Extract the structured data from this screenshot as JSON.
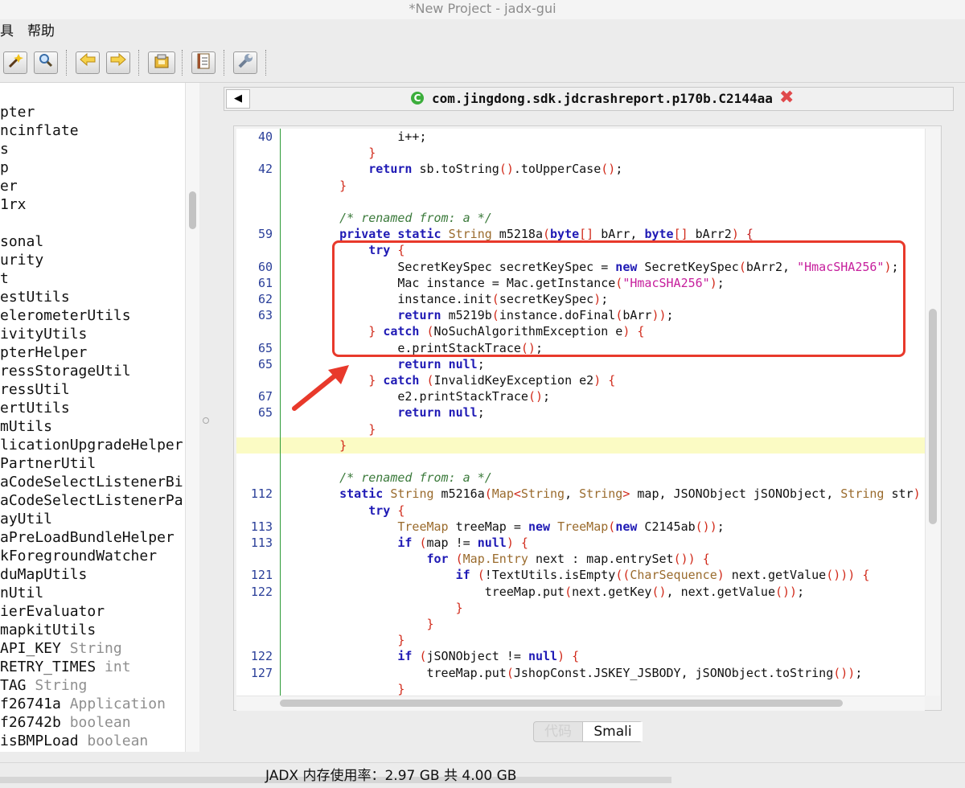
{
  "window": {
    "title": "*New Project - jadx-gui"
  },
  "menu": {
    "items": [
      "具",
      "帮助"
    ]
  },
  "toolbar": {
    "icons": [
      "wand-icon",
      "search-icon",
      "back-arrow-icon",
      "forward-arrow-icon",
      "decompile-icon",
      "log-icon",
      "preferences-icon"
    ]
  },
  "tree": {
    "items": [
      {
        "name": "pter",
        "type": ""
      },
      {
        "name": "ncinflate",
        "type": ""
      },
      {
        "name": "s",
        "type": ""
      },
      {
        "name": "p",
        "type": ""
      },
      {
        "name": "er",
        "type": ""
      },
      {
        "name": "1rx",
        "type": ""
      },
      {
        "name": "",
        "type": ""
      },
      {
        "name": "sonal",
        "type": ""
      },
      {
        "name": "urity",
        "type": ""
      },
      {
        "name": "t",
        "type": ""
      },
      {
        "name": "estUtils",
        "type": ""
      },
      {
        "name": "elerometerUtils",
        "type": ""
      },
      {
        "name": "ivityUtils",
        "type": ""
      },
      {
        "name": "pterHelper",
        "type": ""
      },
      {
        "name": "ressStorageUtil",
        "type": ""
      },
      {
        "name": "ressUtil",
        "type": ""
      },
      {
        "name": "ertUtils",
        "type": ""
      },
      {
        "name": "mUtils",
        "type": ""
      },
      {
        "name": "licationUpgradeHelper",
        "type": ""
      },
      {
        "name": "PartnerUtil",
        "type": ""
      },
      {
        "name": "aCodeSelectListenerBi",
        "type": ""
      },
      {
        "name": "aCodeSelectListenerPa",
        "type": ""
      },
      {
        "name": "ayUtil",
        "type": ""
      },
      {
        "name": "aPreLoadBundleHelper",
        "type": ""
      },
      {
        "name": "kForegroundWatcher",
        "type": ""
      },
      {
        "name": "duMapUtils",
        "type": ""
      },
      {
        "name": "nUtil",
        "type": ""
      },
      {
        "name": "ierEvaluator",
        "type": ""
      },
      {
        "name": "mapkitUtils",
        "type": ""
      },
      {
        "name": "API_KEY",
        "type": "String"
      },
      {
        "name": "RETRY_TIMES",
        "type": "int"
      },
      {
        "name": "TAG",
        "type": "String"
      },
      {
        "name": "f26741a",
        "type": "Application"
      },
      {
        "name": "f26742b",
        "type": "boolean"
      },
      {
        "name": "isBMPLoad",
        "type": "boolean"
      }
    ]
  },
  "tab": {
    "title": "com.jingdong.sdk.jdcrashreport.p170b.C2144aa",
    "back_label": "◀"
  },
  "code": {
    "lines": [
      {
        "num": "40",
        "hl": false
      },
      {
        "num": "",
        "hl": false
      },
      {
        "num": "42",
        "hl": false
      },
      {
        "num": "",
        "hl": false
      },
      {
        "num": "",
        "hl": false
      },
      {
        "num": "",
        "hl": false
      },
      {
        "num": "59",
        "hl": false
      },
      {
        "num": "",
        "hl": false
      },
      {
        "num": "60",
        "hl": false
      },
      {
        "num": "61",
        "hl": false
      },
      {
        "num": "62",
        "hl": false
      },
      {
        "num": "63",
        "hl": false
      },
      {
        "num": "",
        "hl": false
      },
      {
        "num": "65",
        "hl": false
      },
      {
        "num": "65",
        "hl": false
      },
      {
        "num": "",
        "hl": false
      },
      {
        "num": "67",
        "hl": false
      },
      {
        "num": "65",
        "hl": false
      },
      {
        "num": "",
        "hl": false
      },
      {
        "num": "",
        "hl": true
      },
      {
        "num": "",
        "hl": false
      },
      {
        "num": "",
        "hl": false
      },
      {
        "num": "112",
        "hl": false
      },
      {
        "num": "",
        "hl": false
      },
      {
        "num": "113",
        "hl": false
      },
      {
        "num": "113",
        "hl": false
      },
      {
        "num": "",
        "hl": false
      },
      {
        "num": "121",
        "hl": false
      },
      {
        "num": "122",
        "hl": false
      },
      {
        "num": "",
        "hl": false
      },
      {
        "num": "",
        "hl": false
      },
      {
        "num": "",
        "hl": false
      },
      {
        "num": "122",
        "hl": false
      },
      {
        "num": "127",
        "hl": false
      },
      {
        "num": "",
        "hl": false
      }
    ],
    "text": [
      [
        [
          "f",
          "            i++;"
        ]
      ],
      [
        [
          "f",
          "        "
        ],
        [
          "p",
          "}"
        ]
      ],
      [
        [
          "f",
          "        "
        ],
        [
          "k",
          "return"
        ],
        [
          "f",
          " sb.toString"
        ],
        [
          "p",
          "()"
        ],
        [
          "f",
          ".toUpperCase"
        ],
        [
          "p",
          "()"
        ],
        [
          "f",
          ";"
        ]
      ],
      [
        [
          "f",
          "    "
        ],
        [
          "p",
          "}"
        ]
      ],
      [
        [
          "f",
          ""
        ]
      ],
      [
        [
          "f",
          "    "
        ],
        [
          "c",
          "/* renamed from: a */"
        ]
      ],
      [
        [
          "f",
          "    "
        ],
        [
          "k",
          "private static"
        ],
        [
          "f",
          " "
        ],
        [
          "t",
          "String"
        ],
        [
          "f",
          " m5218a"
        ],
        [
          "p",
          "("
        ],
        [
          "k",
          "byte"
        ],
        [
          "p",
          "[]"
        ],
        [
          "f",
          " bArr, "
        ],
        [
          "k",
          "byte"
        ],
        [
          "p",
          "[]"
        ],
        [
          "f",
          " bArr2"
        ],
        [
          "p",
          ")"
        ],
        [
          "f",
          " "
        ],
        [
          "b",
          "{"
        ]
      ],
      [
        [
          "f",
          "        "
        ],
        [
          "k",
          "try"
        ],
        [
          "f",
          " "
        ],
        [
          "p",
          "{"
        ]
      ],
      [
        [
          "f",
          "            SecretKeySpec secretKeySpec = "
        ],
        [
          "k",
          "new"
        ],
        [
          "f",
          " SecretKeySpec"
        ],
        [
          "p",
          "("
        ],
        [
          "f",
          "bArr2, "
        ],
        [
          "s",
          "\"HmacSHA256\""
        ],
        [
          "p",
          ")"
        ],
        [
          "f",
          ";"
        ]
      ],
      [
        [
          "f",
          "            Mac instance = Mac.getInstance"
        ],
        [
          "p",
          "("
        ],
        [
          "s",
          "\"HmacSHA256\""
        ],
        [
          "p",
          ")"
        ],
        [
          "f",
          ";"
        ]
      ],
      [
        [
          "f",
          "            instance.init"
        ],
        [
          "p",
          "("
        ],
        [
          "f",
          "secretKeySpec"
        ],
        [
          "p",
          ")"
        ],
        [
          "f",
          ";"
        ]
      ],
      [
        [
          "f",
          "            "
        ],
        [
          "k",
          "return"
        ],
        [
          "f",
          " m5219b"
        ],
        [
          "p",
          "("
        ],
        [
          "f",
          "instance.doFinal"
        ],
        [
          "p",
          "("
        ],
        [
          "f",
          "bArr"
        ],
        [
          "p",
          "))"
        ],
        [
          "f",
          ";"
        ]
      ],
      [
        [
          "f",
          "        "
        ],
        [
          "p",
          "}"
        ],
        [
          "f",
          " "
        ],
        [
          "k",
          "catch"
        ],
        [
          "f",
          " "
        ],
        [
          "p",
          "("
        ],
        [
          "f",
          "NoSuchAlgorithmException e"
        ],
        [
          "p",
          ")"
        ],
        [
          "f",
          " "
        ],
        [
          "p",
          "{"
        ]
      ],
      [
        [
          "f",
          "            e.printStackTrace"
        ],
        [
          "p",
          "()"
        ],
        [
          "f",
          ";"
        ]
      ],
      [
        [
          "f",
          "            "
        ],
        [
          "k",
          "return null"
        ],
        [
          "f",
          ";"
        ]
      ],
      [
        [
          "f",
          "        "
        ],
        [
          "p",
          "}"
        ],
        [
          "f",
          " "
        ],
        [
          "k",
          "catch"
        ],
        [
          "f",
          " "
        ],
        [
          "p",
          "("
        ],
        [
          "f",
          "InvalidKeyException e2"
        ],
        [
          "p",
          ")"
        ],
        [
          "f",
          " "
        ],
        [
          "p",
          "{"
        ]
      ],
      [
        [
          "f",
          "            e2.printStackTrace"
        ],
        [
          "p",
          "()"
        ],
        [
          "f",
          ";"
        ]
      ],
      [
        [
          "f",
          "            "
        ],
        [
          "k",
          "return null"
        ],
        [
          "f",
          ";"
        ]
      ],
      [
        [
          "f",
          "        "
        ],
        [
          "p",
          "}"
        ]
      ],
      [
        [
          "f",
          "    "
        ],
        [
          "p",
          "}"
        ]
      ],
      [
        [
          "f",
          ""
        ]
      ],
      [
        [
          "f",
          "    "
        ],
        [
          "c",
          "/* renamed from: a */"
        ]
      ],
      [
        [
          "f",
          "    "
        ],
        [
          "k",
          "static"
        ],
        [
          "f",
          " "
        ],
        [
          "t",
          "String"
        ],
        [
          "f",
          " m5216a"
        ],
        [
          "p",
          "("
        ],
        [
          "t",
          "Map"
        ],
        [
          "p",
          "<"
        ],
        [
          "t",
          "String"
        ],
        [
          "f",
          ", "
        ],
        [
          "t",
          "String"
        ],
        [
          "p",
          ">"
        ],
        [
          "f",
          " map, JSONObject jSONObject, "
        ],
        [
          "t",
          "String"
        ],
        [
          "f",
          " str"
        ],
        [
          "p",
          ")"
        ]
      ],
      [
        [
          "f",
          "        "
        ],
        [
          "k",
          "try"
        ],
        [
          "f",
          " "
        ],
        [
          "p",
          "{"
        ]
      ],
      [
        [
          "f",
          "            "
        ],
        [
          "t",
          "TreeMap"
        ],
        [
          "f",
          " treeMap = "
        ],
        [
          "k",
          "new"
        ],
        [
          "f",
          " "
        ],
        [
          "t",
          "TreeMap"
        ],
        [
          "p",
          "("
        ],
        [
          "k",
          "new"
        ],
        [
          "f",
          " C2145ab"
        ],
        [
          "p",
          "())"
        ],
        [
          "f",
          ";"
        ]
      ],
      [
        [
          "f",
          "            "
        ],
        [
          "k",
          "if"
        ],
        [
          "f",
          " "
        ],
        [
          "p",
          "("
        ],
        [
          "f",
          "map != "
        ],
        [
          "k",
          "null"
        ],
        [
          "p",
          ")"
        ],
        [
          "f",
          " "
        ],
        [
          "p",
          "{"
        ]
      ],
      [
        [
          "f",
          "                "
        ],
        [
          "k",
          "for"
        ],
        [
          "f",
          " "
        ],
        [
          "p",
          "("
        ],
        [
          "t",
          "Map.Entry"
        ],
        [
          "f",
          " next : map.entrySet"
        ],
        [
          "p",
          "())"
        ],
        [
          "f",
          " "
        ],
        [
          "p",
          "{"
        ]
      ],
      [
        [
          "f",
          "                    "
        ],
        [
          "k",
          "if"
        ],
        [
          "f",
          " "
        ],
        [
          "p",
          "("
        ],
        [
          "f",
          "!TextUtils.isEmpty"
        ],
        [
          "p",
          "(("
        ],
        [
          "t",
          "CharSequence"
        ],
        [
          "p",
          ")"
        ],
        [
          "f",
          " next.getValue"
        ],
        [
          "p",
          "()))"
        ],
        [
          "f",
          " "
        ],
        [
          "p",
          "{"
        ]
      ],
      [
        [
          "f",
          "                        treeMap.put"
        ],
        [
          "p",
          "("
        ],
        [
          "f",
          "next.getKey"
        ],
        [
          "p",
          "()"
        ],
        [
          "f",
          ", next.getValue"
        ],
        [
          "p",
          "())"
        ],
        [
          "f",
          ";"
        ]
      ],
      [
        [
          "f",
          "                    "
        ],
        [
          "p",
          "}"
        ]
      ],
      [
        [
          "f",
          "                "
        ],
        [
          "p",
          "}"
        ]
      ],
      [
        [
          "f",
          "            "
        ],
        [
          "p",
          "}"
        ]
      ],
      [
        [
          "f",
          "            "
        ],
        [
          "k",
          "if"
        ],
        [
          "f",
          " "
        ],
        [
          "p",
          "("
        ],
        [
          "f",
          "jSONObject != "
        ],
        [
          "k",
          "null"
        ],
        [
          "p",
          ")"
        ],
        [
          "f",
          " "
        ],
        [
          "p",
          "{"
        ]
      ],
      [
        [
          "f",
          "                treeMap.put"
        ],
        [
          "p",
          "("
        ],
        [
          "f",
          "JshopConst.JSKEY_JSBODY, jSONObject.toString"
        ],
        [
          "p",
          "())"
        ],
        [
          "f",
          ";"
        ]
      ],
      [
        [
          "f",
          "            "
        ],
        [
          "p",
          "}"
        ]
      ]
    ]
  },
  "bottom_tabs": {
    "code_label": "代码",
    "smali_label": "Smali"
  },
  "status": {
    "memory_text": "JADX 内存使用率：2.97 GB 共 4.00 GB"
  },
  "colors": {
    "keyword": "#1f1ab5",
    "type": "#9a6b2d",
    "string": "#c61e9c",
    "comment": "#3b7a3b",
    "paren": "#d12a1a",
    "annotation_box": "#e8392b",
    "highlight_line": "#fbfbc4"
  }
}
